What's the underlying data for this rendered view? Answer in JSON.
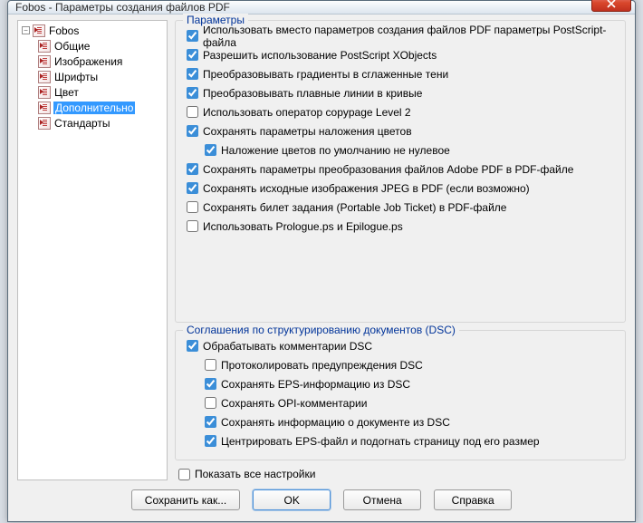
{
  "titlebar": "Fobos - Параметры создания файлов PDF",
  "tree": {
    "root": "Fobos",
    "items": [
      {
        "label": "Общие"
      },
      {
        "label": "Изображения"
      },
      {
        "label": "Шрифты"
      },
      {
        "label": "Цвет"
      },
      {
        "label": "Дополнительно"
      },
      {
        "label": "Стандарты"
      }
    ]
  },
  "group1": {
    "title": "Параметры",
    "chk": [
      {
        "label": "Использовать вместо параметров создания файлов PDF параметры PostScript-файла",
        "checked": true
      },
      {
        "label": "Разрешить использование PostScript XObjects",
        "checked": true
      },
      {
        "label": "Преобразовывать градиенты в сглаженные тени",
        "checked": true
      },
      {
        "label": "Преобразовывать плавные линии в кривые",
        "checked": true
      },
      {
        "label": "Использовать оператор copypage Level 2",
        "checked": false
      },
      {
        "label": "Сохранять параметры наложения цветов",
        "checked": true
      },
      {
        "label": "Наложение цветов по умолчанию не нулевое",
        "checked": true,
        "indent": true
      },
      {
        "label": "Сохранять параметры преобразования файлов Adobe PDF в PDF-файле",
        "checked": true
      },
      {
        "label": "Сохранять исходные  изображения JPEG в PDF (если возможно)",
        "checked": true
      },
      {
        "label": "Сохранять билет задания (Portable Job Ticket) в PDF-файле",
        "checked": false
      },
      {
        "label": "Использовать Prologue.ps и Epilogue.ps",
        "checked": false
      }
    ]
  },
  "group2": {
    "title": "Соглашения по структурированию документов (DSC)",
    "chk": [
      {
        "label": "Обрабатывать комментарии DSC",
        "checked": true
      },
      {
        "label": "Протоколировать предупреждения DSC",
        "checked": false,
        "indent": true
      },
      {
        "label": "Сохранять EPS-информацию из DSC",
        "checked": true,
        "indent": true
      },
      {
        "label": "Сохранять OPI-комментарии",
        "checked": false,
        "indent": true
      },
      {
        "label": "Сохранять информацию о документе из DSC",
        "checked": true,
        "indent": true
      },
      {
        "label": "Центрировать EPS-файл и подогнать страницу под его размер",
        "checked": true,
        "indent": true
      }
    ]
  },
  "showAll": "Показать все настройки",
  "buttons": {
    "saveAs": "Сохранить как...",
    "ok": "OK",
    "cancel": "Отмена",
    "help": "Справка"
  }
}
